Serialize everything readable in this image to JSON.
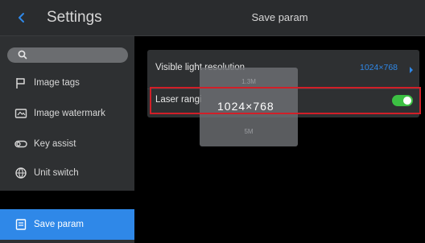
{
  "sidebar": {
    "title": "Settings",
    "search": {
      "placeholder": ""
    },
    "items": [
      {
        "label": "Image tags",
        "icon": "flag-icon"
      },
      {
        "label": "Image watermark",
        "icon": "watermark-icon"
      },
      {
        "label": "Key assist",
        "icon": "key-toggle-icon"
      },
      {
        "label": "Unit switch",
        "icon": "globe-icon"
      },
      {
        "label": "Save param",
        "icon": "save-param-icon",
        "active": true
      }
    ]
  },
  "main": {
    "title": "Save param",
    "rows": [
      {
        "label": "Visible light resolution",
        "value": "1024×768"
      },
      {
        "label": "Laser rangi",
        "toggle_on": true
      }
    ]
  },
  "picker": {
    "options": [
      "1.3M",
      "1024×768",
      "5M"
    ],
    "selected": "1024×768"
  },
  "colors": {
    "accent": "#2f88e8",
    "toggle_on": "#3cc043",
    "highlight": "#d11f28"
  }
}
